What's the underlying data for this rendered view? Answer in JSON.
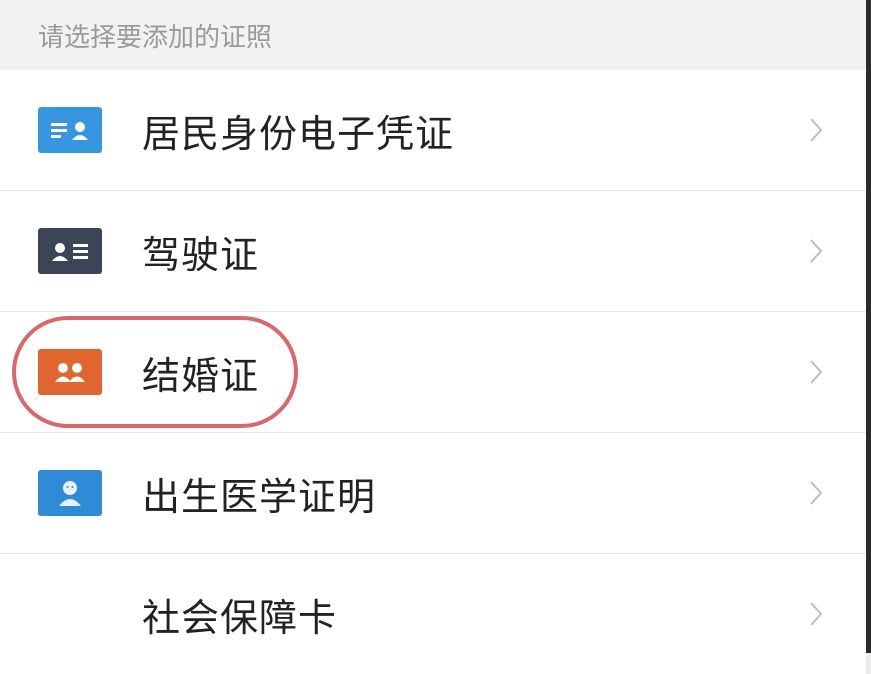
{
  "section_header": "请选择要添加的证照",
  "accent_colors": {
    "id_card": "#3796e0",
    "driver_license": "#3b4557",
    "marriage": "#e0652e",
    "birth": "#2f8ad8",
    "highlight": "#d9676b"
  },
  "items": [
    {
      "label": "居民身份电子凭证",
      "icon": "id-card-icon",
      "highlighted": false
    },
    {
      "label": "驾驶证",
      "icon": "driver-license-icon",
      "highlighted": false
    },
    {
      "label": "结婚证",
      "icon": "marriage-certificate-icon",
      "highlighted": true
    },
    {
      "label": "出生医学证明",
      "icon": "birth-certificate-icon",
      "highlighted": false
    },
    {
      "label": "社会保障卡",
      "icon": null,
      "highlighted": false
    }
  ]
}
